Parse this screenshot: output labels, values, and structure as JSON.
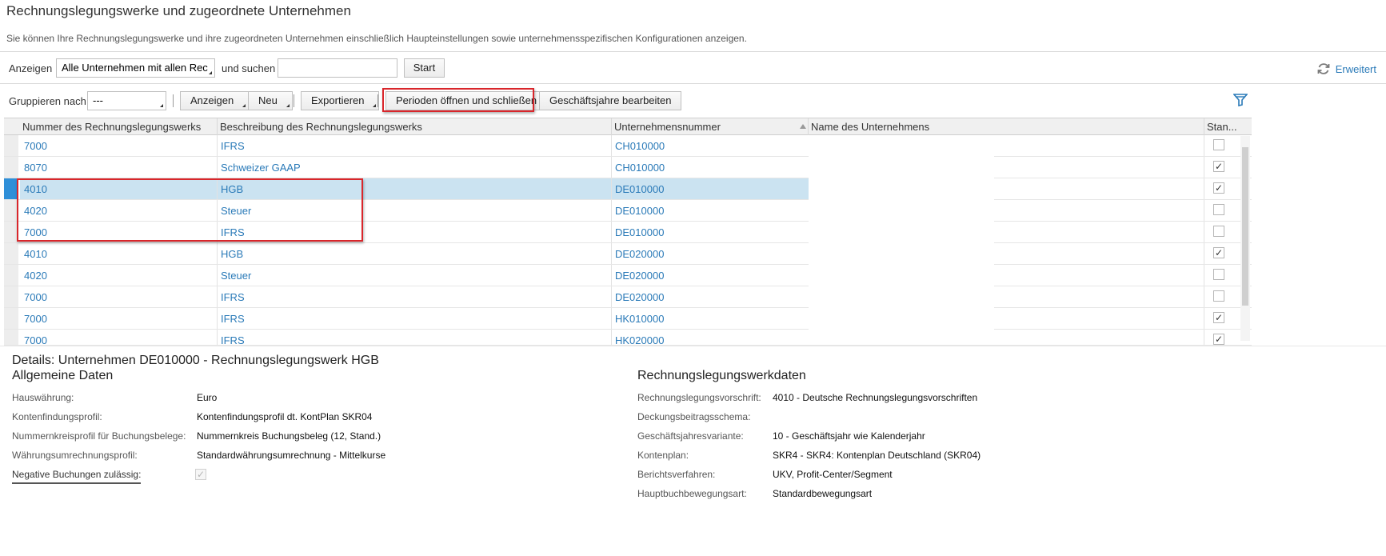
{
  "page": {
    "title": "Rechnungslegungswerke und zugeordnete Unternehmen",
    "subtitle": "Sie können Ihre Rechnungslegungswerke und ihre zugeordneten Unternehmen einschließlich Haupteinstellungen sowie unternehmensspezifischen Konfigurationen anzeigen."
  },
  "search": {
    "show_label": "Anzeigen",
    "show_value": "Alle Unternehmen mit allen Rec",
    "and_search_label": "und suchen",
    "search_value": "",
    "start_label": "Start",
    "advanced_label": "Erweitert"
  },
  "toolbar": {
    "group_label": "Gruppieren nach",
    "group_value": "---",
    "show_btn": "Anzeigen",
    "new_btn": "Neu",
    "export_btn": "Exportieren",
    "periods_btn": "Perioden öffnen und schließen",
    "fiscal_btn": "Geschäftsjahre bearbeiten"
  },
  "table": {
    "columns": [
      "Nummer des Rechnungslegungswerks",
      "Beschreibung des Rechnungslegungswerks",
      "Unternehmensnummer",
      "Name des Unternehmens",
      "Stan..."
    ],
    "rows": [
      {
        "nr": "7000",
        "desc": "IFRS",
        "company": "CH010000",
        "checked": false,
        "selected": false
      },
      {
        "nr": "8070",
        "desc": "Schweizer GAAP",
        "company": "CH010000",
        "checked": true,
        "selected": false
      },
      {
        "nr": "4010",
        "desc": "HGB",
        "company": "DE010000",
        "checked": true,
        "selected": true
      },
      {
        "nr": "4020",
        "desc": "Steuer",
        "company": "DE010000",
        "checked": false,
        "selected": false
      },
      {
        "nr": "7000",
        "desc": "IFRS",
        "company": "DE010000",
        "checked": false,
        "selected": false
      },
      {
        "nr": "4010",
        "desc": "HGB",
        "company": "DE020000",
        "checked": true,
        "selected": false
      },
      {
        "nr": "4020",
        "desc": "Steuer",
        "company": "DE020000",
        "checked": false,
        "selected": false
      },
      {
        "nr": "7000",
        "desc": "IFRS",
        "company": "DE020000",
        "checked": false,
        "selected": false
      },
      {
        "nr": "7000",
        "desc": "IFRS",
        "company": "HK010000",
        "checked": true,
        "selected": false
      },
      {
        "nr": "7000",
        "desc": "IFRS",
        "company": "HK020000",
        "checked": true,
        "selected": false
      }
    ]
  },
  "details": {
    "title": "Details: Unternehmen DE010000 - Rechnungslegungswerk HGB",
    "general_title": "Allgemeine Daten",
    "ledger_title": "Rechnungslegungswerkdaten",
    "general": [
      {
        "key": "Hauswährung:",
        "value": "Euro"
      },
      {
        "key": "Kontenfindungsprofil:",
        "value": "Kontenfindungsprofil dt. KontPlan SKR04"
      },
      {
        "key": "Nummernkreisprofil für Buchungsbelege:",
        "value": "Nummernkreis Buchungsbeleg (12, Stand.)"
      },
      {
        "key": "Währungsumrechnungsprofil:",
        "value": "Standardwährungsumrechnung - Mittelkurse"
      }
    ],
    "negative_label": "Negative Buchungen zulässig:",
    "negative_checked": true,
    "ledger": [
      {
        "key": "Rechnungslegungsvorschrift:",
        "value": "4010 - Deutsche Rechnungslegungsvorschriften"
      },
      {
        "key": "Deckungsbeitragsschema:",
        "value": ""
      },
      {
        "key": "Geschäftsjahresvariante:",
        "value": "10 - Geschäftsjahr wie Kalenderjahr"
      },
      {
        "key": "Kontenplan:",
        "value": "SKR4 - SKR4: Kontenplan Deutschland (SKR04)"
      },
      {
        "key": "Berichtsverfahren:",
        "value": "UKV, Profit-Center/Segment"
      },
      {
        "key": "Hauptbuchbewegungsart:",
        "value": "Standardbewegungsart"
      }
    ]
  },
  "colors": {
    "link": "#2a7ab8",
    "selected_row": "#cbe3f1",
    "highlight": "#d9262b"
  }
}
